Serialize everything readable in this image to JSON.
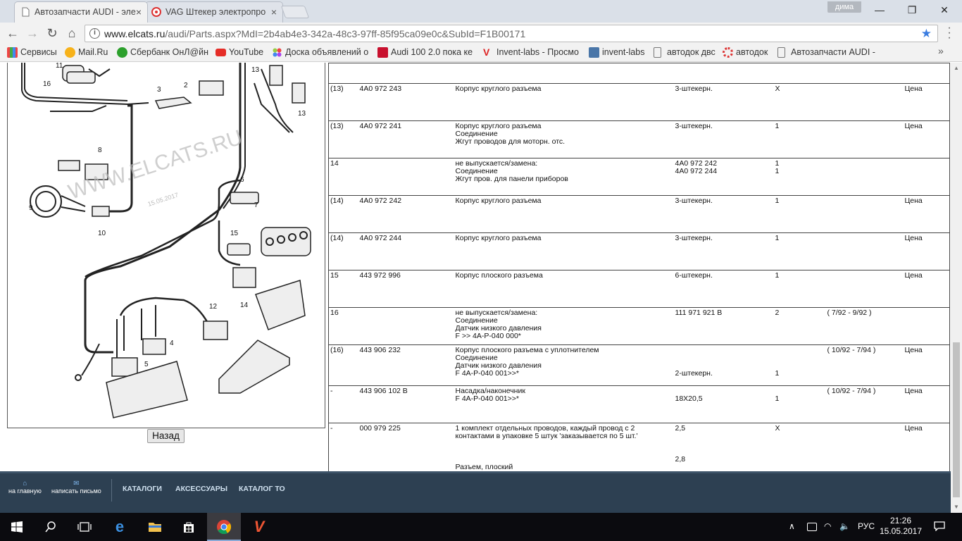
{
  "browser": {
    "tabs": [
      {
        "title": "Автозапчасти AUDI - эле",
        "active": true
      },
      {
        "title": "VAG Штекер электропро",
        "active": false
      }
    ],
    "user": "дима",
    "url_host": "www.elcats.ru",
    "url_path": "/audi/Parts.aspx?MdI=2b4ab4e3-342a-48c3-97ff-85f95ca09e0c&SubId=F1B00171",
    "bookmarks": [
      "Сервисы",
      "Mail.Ru",
      "Сбербанк ОнЛ@йн",
      "YouTube",
      "Доска объявлений о",
      "Audi 100 2.0 пока ке",
      "Invent-labs - Просмо",
      "invent-labs",
      "автодок двс",
      "автодок",
      "Автозапчасти AUDI -"
    ],
    "bookmarks_more": "»"
  },
  "diagram": {
    "watermark": "WWW.ELCATS.RU",
    "date": "15.05.2017",
    "callouts": [
      "11",
      "16",
      "3",
      "2",
      "13",
      "13",
      "8",
      "9",
      "10",
      "6",
      "7",
      "15",
      "14",
      "12",
      "4",
      "5"
    ]
  },
  "back_button": "Назад",
  "parts": [
    {
      "pos": "(13)",
      "num": "4A0 972 243",
      "desc": [
        "Корпус круглого разъема"
      ],
      "note": [
        "3-штекерн."
      ],
      "qty": [
        "X"
      ],
      "date": "",
      "price": "Цена"
    },
    {
      "pos": "(13)",
      "num": "4A0 972 241",
      "desc": [
        "Корпус круглого разъема",
        "Соединение",
        "Жгут проводов для моторн. отс."
      ],
      "note": [
        "3-штекерн."
      ],
      "qty": [
        "1"
      ],
      "date": "",
      "price": "Цена"
    },
    {
      "pos": "14",
      "num": "",
      "desc": [
        "не выпускается/замена:",
        "Соединение",
        "Жгут пров. для панели приборов"
      ],
      "note": [
        "4A0 972 242",
        "4A0 972 244"
      ],
      "qty": [
        "1",
        "1"
      ],
      "date": "",
      "price": ""
    },
    {
      "pos": "(14)",
      "num": "4A0 972 242",
      "desc": [
        "Корпус круглого разъема"
      ],
      "note": [
        "3-штекерн."
      ],
      "qty": [
        "1"
      ],
      "date": "",
      "price": "Цена"
    },
    {
      "pos": "(14)",
      "num": "4A0 972 244",
      "desc": [
        "Корпус круглого разъема"
      ],
      "note": [
        "3-штекерн."
      ],
      "qty": [
        "1"
      ],
      "date": "",
      "price": "Цена"
    },
    {
      "pos": "15",
      "num": "443 972 996",
      "desc": [
        "Корпус плоского разъема"
      ],
      "note": [
        "6-штекерн."
      ],
      "qty": [
        "1"
      ],
      "date": "",
      "price": "Цена"
    },
    {
      "pos": "16",
      "num": "",
      "desc": [
        "не выпускается/замена:",
        "Соединение",
        "Датчик низкого давления",
        "F >> 4A-P-040 000*"
      ],
      "note": [
        "111 971 921 B"
      ],
      "qty": [
        "2"
      ],
      "date": "( 7/92 - 9/92 )",
      "price": ""
    },
    {
      "pos": "(16)",
      "num": "443 906 232",
      "desc": [
        "Корпус плоского разъема с уплотнителем",
        "Соединение",
        "Датчик низкого давления",
        "F 4A-P-040 001>>*"
      ],
      "note": [
        "",
        "",
        "",
        "2-штекерн."
      ],
      "qty": [
        "",
        "",
        "",
        "1"
      ],
      "date": "( 10/92 - 7/94 )",
      "price": "Цена"
    },
    {
      "pos": "-",
      "num": "443 906 102 B",
      "desc": [
        "Насадка/наконечник",
        "F 4A-P-040 001>>*"
      ],
      "note": [
        "",
        "18X20,5"
      ],
      "qty": [
        "",
        "1"
      ],
      "date": "( 10/92 - 7/94 )",
      "price": "Цена"
    },
    {
      "pos": "-",
      "num": "000 979 225",
      "desc": [
        "1 комплект отдельных проводов, каждый провод с 2",
        "контактами в упаковке 5 штук 'заказывается по 5 шт.'",
        "",
        "",
        "",
        "Разъем, плоский"
      ],
      "note": [
        "2,5",
        "",
        "",
        "",
        "2,8"
      ],
      "qty": [
        "X"
      ],
      "date": "",
      "price": "Цена"
    }
  ],
  "footer": {
    "home": "на главную",
    "mail": "написать письмо",
    "links": [
      "КАТАЛОГИ",
      "АКСЕССУАРЫ",
      "КАТАЛОГ ТО"
    ]
  },
  "taskbar": {
    "lang": "РУС",
    "time": "21:26",
    "date": "15.05.2017"
  }
}
